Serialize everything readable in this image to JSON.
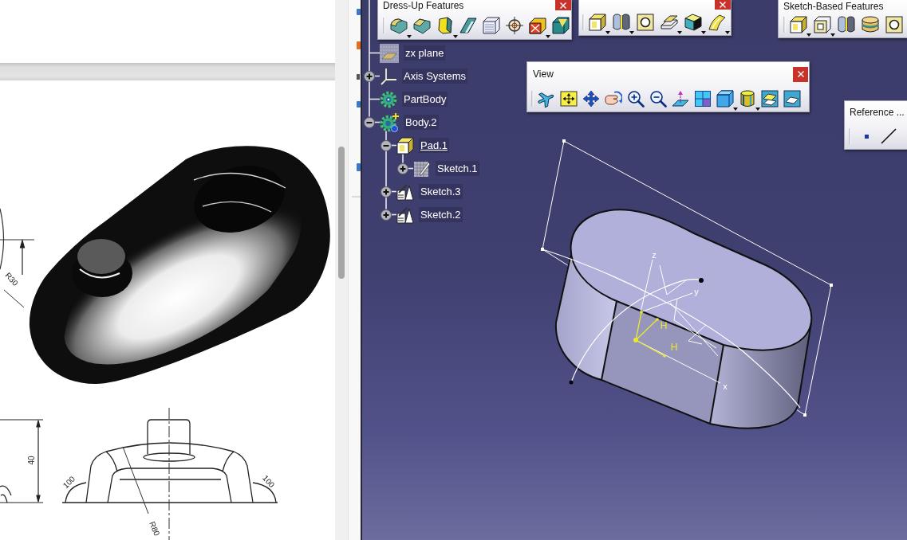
{
  "document": {
    "dimension_labels": [
      "R30",
      "40",
      "100",
      "100",
      "R80"
    ]
  },
  "toolbars": [
    {
      "title": "Dress-Up Features",
      "close_button": true,
      "tools": [
        {
          "kind": "rounded_block",
          "dropdown": true
        },
        {
          "kind": "beveled_block",
          "dropdown": false
        },
        {
          "kind": "tapered_block",
          "dropdown": true
        },
        {
          "kind": "slanted_bar",
          "dropdown": false
        },
        {
          "kind": "hatched_cube",
          "dropdown": false
        },
        {
          "kind": "crosshair",
          "dropdown": false
        },
        {
          "kind": "crossed_box",
          "dropdown": true
        },
        {
          "kind": "faced_cube",
          "dropdown": false
        }
      ]
    },
    {
      "close_button": true,
      "tools": [
        {
          "kind": "block",
          "dropdown": true
        },
        {
          "kind": "split_cylinder",
          "dropdown": true
        },
        {
          "kind": "square_ring",
          "dropdown": false
        },
        {
          "kind": "stacked_plates",
          "dropdown": true
        },
        {
          "kind": "shaded_cube",
          "dropdown": true
        },
        {
          "kind": "curved_surface",
          "dropdown": true
        }
      ]
    },
    {
      "title": "Sketch-Based Features",
      "close_button": false,
      "tools": [
        {
          "kind": "block",
          "dropdown": true
        },
        {
          "kind": "hollow_square",
          "dropdown": true
        },
        {
          "kind": "split_cylinder",
          "dropdown": false
        },
        {
          "kind": "ringed_cylinder",
          "dropdown": false
        },
        {
          "kind": "square_ring",
          "dropdown": false
        }
      ]
    },
    {
      "title": "View",
      "close_button": true,
      "tools": [
        {
          "kind": "airplane",
          "dropdown": false
        },
        {
          "kind": "fit_frame",
          "dropdown": false
        },
        {
          "kind": "four_way_arrow",
          "dropdown": false
        },
        {
          "kind": "hand_arrow",
          "dropdown": false
        },
        {
          "kind": "zoom_in",
          "dropdown": false
        },
        {
          "kind": "zoom_out",
          "dropdown": false
        },
        {
          "kind": "plane_arrow",
          "dropdown": false
        },
        {
          "kind": "four_panels",
          "dropdown": false
        },
        {
          "kind": "cube",
          "dropdown": true
        },
        {
          "kind": "cylinder",
          "dropdown": true
        },
        {
          "kind": "swap_panels",
          "dropdown": false
        },
        {
          "kind": "panel",
          "dropdown": false
        }
      ]
    },
    {
      "title": "Reference ...",
      "close_button": false,
      "tools": [
        {
          "kind": "point",
          "dropdown": false
        },
        {
          "kind": "line",
          "dropdown": false
        }
      ]
    }
  ],
  "tree": [
    {
      "label": "zx plane",
      "kind": "plane",
      "current": false
    },
    {
      "label": "Axis Systems",
      "kind": "axis_system",
      "expanded": false,
      "current": false
    },
    {
      "label": "PartBody",
      "kind": "body",
      "current": false
    },
    {
      "label": "Body.2",
      "kind": "body_plus",
      "expanded": true,
      "current": false,
      "children": [
        {
          "label": "Pad.1",
          "kind": "block",
          "expanded": true,
          "current": true,
          "children": [
            {
              "label": "Sketch.1",
              "kind": "hatched_sketch",
              "expanded": false,
              "current": false
            }
          ]
        },
        {
          "label": "Sketch.3",
          "kind": "sketch",
          "expanded": false,
          "current": false
        },
        {
          "label": "Sketch.2",
          "kind": "sketch",
          "expanded": false,
          "current": false
        }
      ]
    }
  ],
  "viewport": {
    "axis_labels": [
      "z",
      "y",
      "x"
    ],
    "constraint_labels": [
      "H",
      "H"
    ]
  }
}
